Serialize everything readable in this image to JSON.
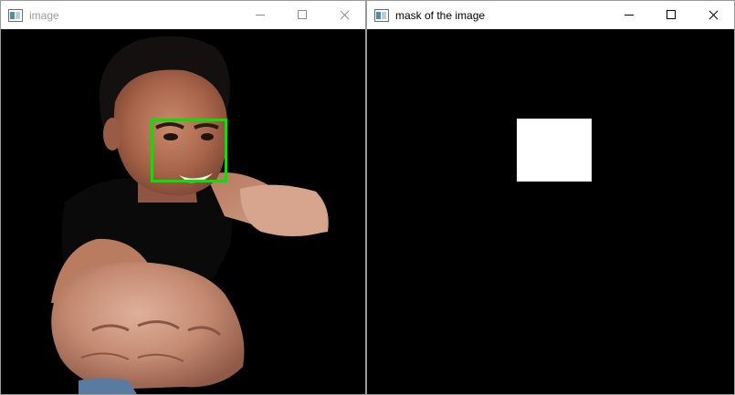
{
  "windows": {
    "image": {
      "title": "image",
      "state": "inactive",
      "detection_box_color": "#00e600"
    },
    "mask": {
      "title": "mask of the image",
      "state": "active",
      "mask_color": "#ffffff"
    }
  },
  "icons": {
    "app": "opencv-window-icon",
    "minimize": "minimize-icon",
    "maximize": "maximize-icon",
    "close": "close-icon"
  }
}
